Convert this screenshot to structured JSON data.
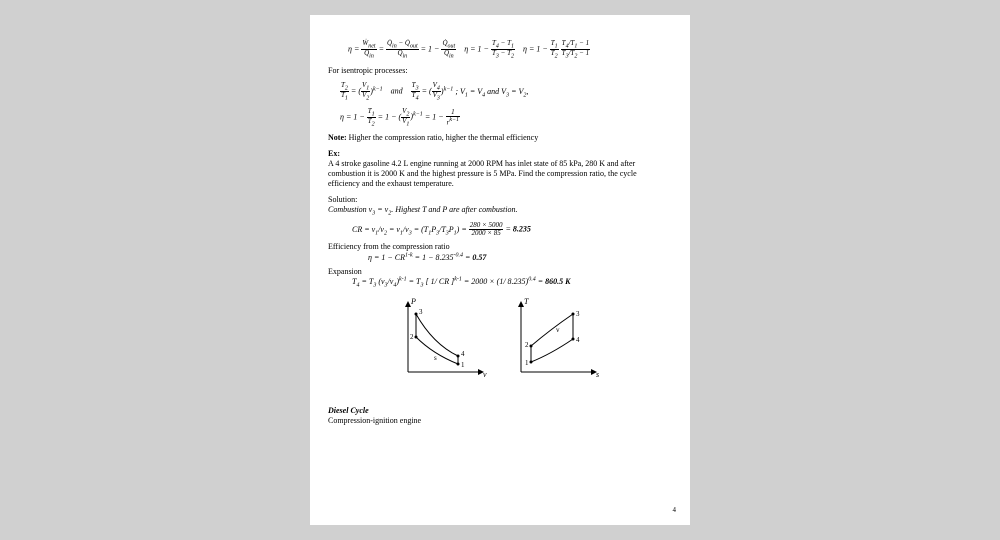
{
  "eta_equations_text": "η = Ẇnet / Q̇in = (Q̇in − Q̇out)/Q̇in = 1 − Q̇out/Q̇in    η = 1 − (T4 − T1)/(T3 − T2)    η = 1 − (T1/T2)·(T4/T1 − 1)/(T3/T2 − 1)",
  "isentropic_header": "For isentropic processes:",
  "isentropic_line1": "T2/T1 = (V1/V2)^(k−1)    and    T3/T4 = (V4/V3)^(k−1) ; V1 = V4 and V3 = V2,",
  "isentropic_line2": "η = 1 − T1/T2 = 1 − (V2/V1)^(k−1) = 1 − 1/r^(k−1)",
  "note_label": "Note:",
  "note_text": "Higher the compression ratio, higher the thermal efficiency",
  "ex_label": "Ex:",
  "ex_text": "A 4 stroke gasoline 4.2 L engine running at 2000 RPM has inlet state of 85 kPa, 280 K and after combustion it is 2000 K and the highest pressure is 5 MPa. Find the compression ratio, the cycle efficiency and the exhaust temperature.",
  "solution_label": "Solution:",
  "combustion_text": "Combustion v3 = v2. Highest T and P are after combustion.",
  "cr_equation": "CR = v1/v2 = v1/v3 = (T1P3/T3P1) = (280 × 5000)/(2000 × 85) = 8.235",
  "cr_value": "8.235",
  "eff_label": "Efficiency from the compression ratio",
  "eff_equation": "η = 1 − CR^(1-k) = 1 − 8.235^(-0.4) = 0.57",
  "eff_value": "0.57",
  "expansion_label": "Expansion",
  "t4_equation": "T4 = T3 (v3/v4)^(k-1) = T3 [ 1/CR ]^(k-1) = 2000 × (1/8.235)^0.4 = 860.5 K",
  "t4_value": "860.5 K",
  "diesel_title": "Diesel Cycle",
  "diesel_sub": "Compression-ignition engine",
  "page_num": "4",
  "chart_data": [
    {
      "type": "line",
      "title": "",
      "xlabel": "v",
      "ylabel": "P",
      "points": [
        {
          "label": "1",
          "x": 60,
          "y": 10
        },
        {
          "label": "2",
          "x": 12,
          "y": 35
        },
        {
          "label": "3",
          "x": 12,
          "y": 60
        },
        {
          "label": "4",
          "x": 60,
          "y": 18
        }
      ],
      "paths": [
        "1→2 curve",
        "2→3 vertical",
        "3→4 curve",
        "4→1 vertical"
      ]
    },
    {
      "type": "line",
      "title": "",
      "xlabel": "s",
      "ylabel": "T",
      "points": [
        {
          "label": "1",
          "x": 12,
          "y": 10
        },
        {
          "label": "2",
          "x": 12,
          "y": 28
        },
        {
          "label": "3",
          "x": 55,
          "y": 60
        },
        {
          "label": "4",
          "x": 55,
          "y": 30
        }
      ],
      "paths": [
        "1→2 vertical",
        "2→3 curve",
        "3→4 vertical",
        "4→1 curve"
      ]
    }
  ]
}
